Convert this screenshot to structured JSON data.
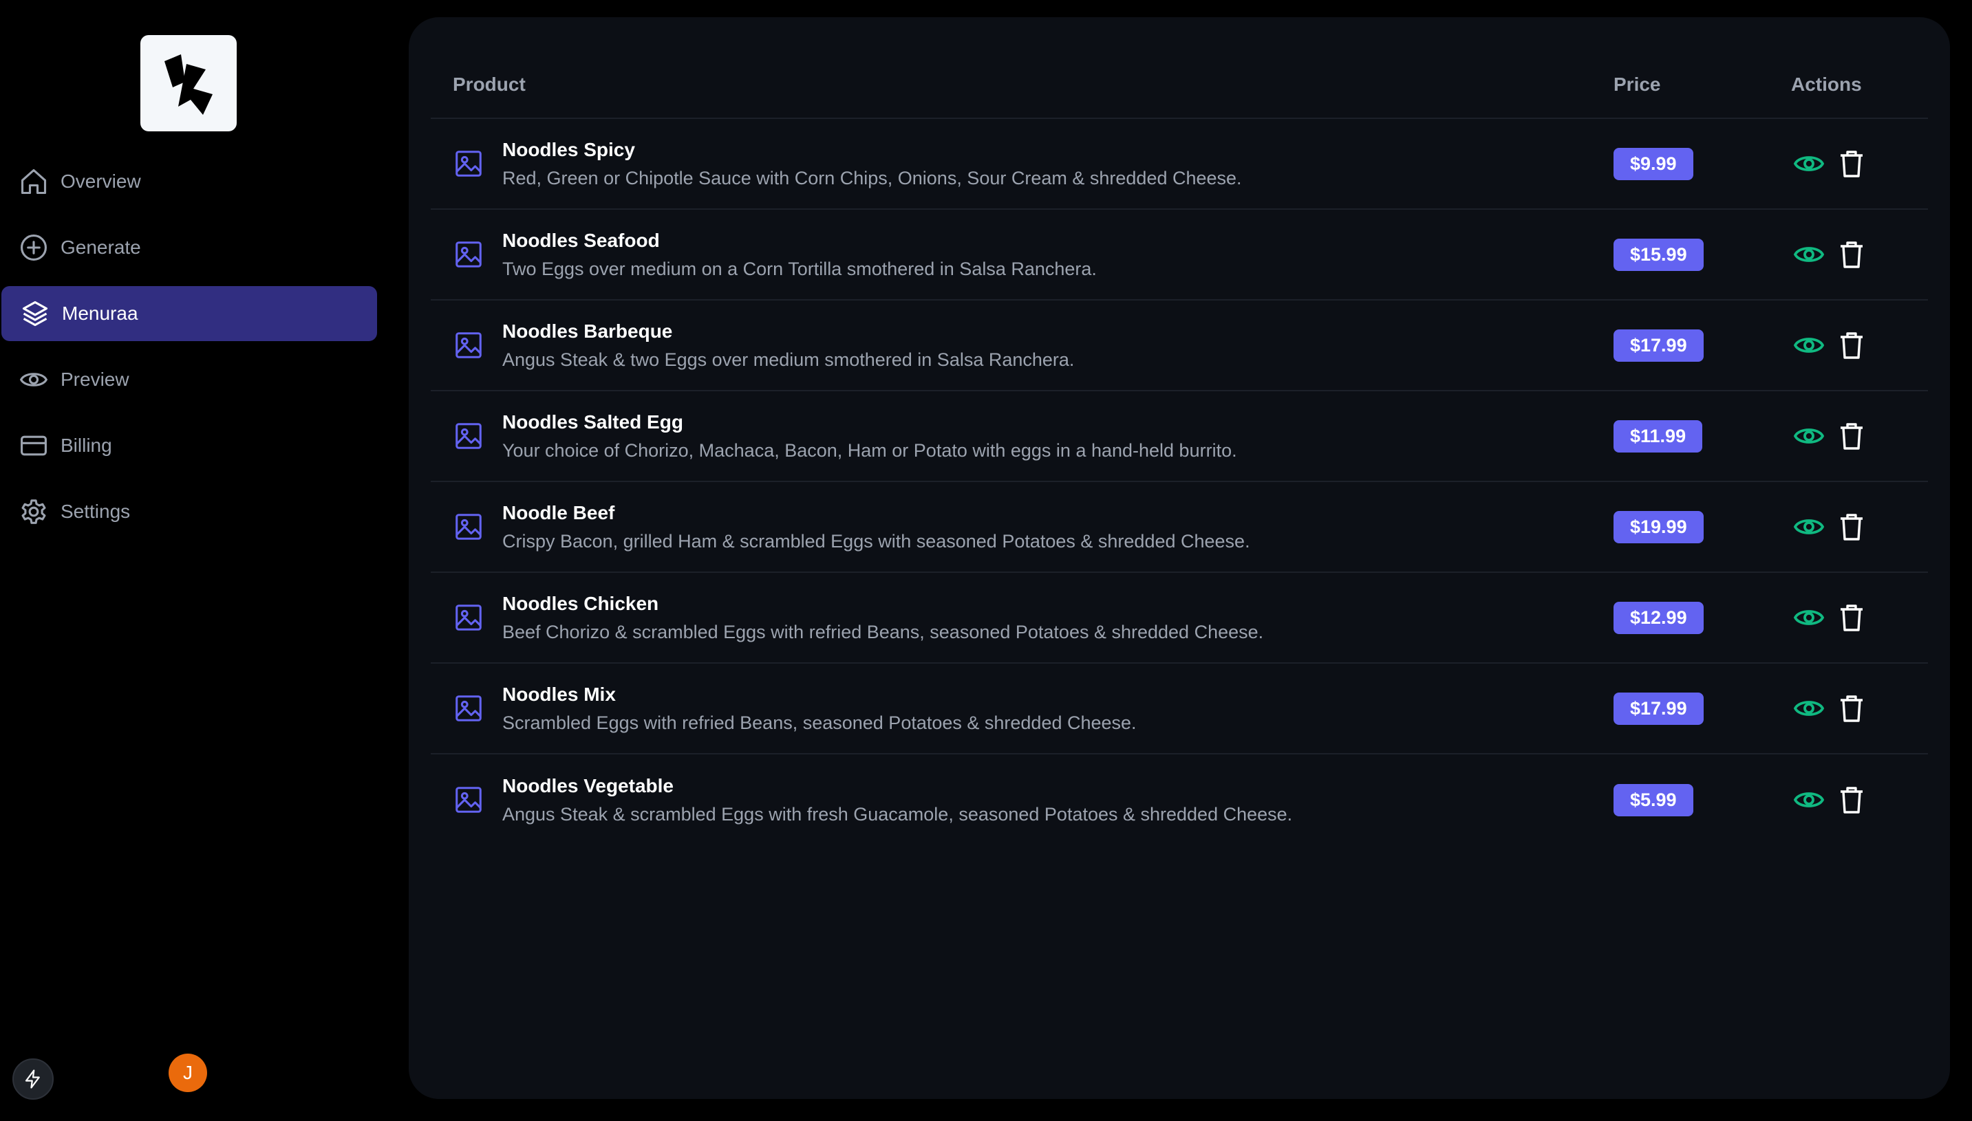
{
  "colors": {
    "accent": "#6363f1",
    "active_nav": "#312e81",
    "eye": "#10b981",
    "panel": "#0c0f15",
    "avatar": "#ea6a0c"
  },
  "sidebar": {
    "items": [
      {
        "label": "Overview",
        "icon": "home-icon"
      },
      {
        "label": "Generate",
        "icon": "plus-circle-icon"
      },
      {
        "label": "Menuraa",
        "icon": "layers-icon",
        "active": true
      },
      {
        "label": "Preview",
        "icon": "eye-icon"
      },
      {
        "label": "Billing",
        "icon": "credit-card-icon"
      },
      {
        "label": "Settings",
        "icon": "gear-icon"
      }
    ],
    "avatar_initial": "J"
  },
  "table": {
    "headers": {
      "product": "Product",
      "price": "Price",
      "actions": "Actions"
    },
    "rows": [
      {
        "name": "Noodles Spicy",
        "desc": "Red, Green or Chipotle Sauce with Corn Chips, Onions, Sour Cream & shredded Cheese.",
        "price": "$9.99"
      },
      {
        "name": "Noodles Seafood",
        "desc": "Two Eggs over medium on a Corn Tortilla smothered in Salsa Ranchera.",
        "price": "$15.99"
      },
      {
        "name": "Noodles Barbeque",
        "desc": "Angus Steak & two Eggs over medium smothered in Salsa Ranchera.",
        "price": "$17.99"
      },
      {
        "name": "Noodles Salted Egg",
        "desc": "Your choice of Chorizo, Machaca, Bacon, Ham or Potato with eggs in a hand-held burrito.",
        "price": "$11.99"
      },
      {
        "name": "Noodle Beef",
        "desc": "Crispy Bacon, grilled Ham & scrambled Eggs with seasoned Potatoes & shredded Cheese.",
        "price": "$19.99"
      },
      {
        "name": "Noodles Chicken",
        "desc": "Beef Chorizo & scrambled Eggs with refried Beans, seasoned Potatoes & shredded Cheese.",
        "price": "$12.99"
      },
      {
        "name": "Noodles Mix",
        "desc": "Scrambled Eggs with refried Beans, seasoned Potatoes & shredded Cheese.",
        "price": "$17.99"
      },
      {
        "name": "Noodles Vegetable",
        "desc": "Angus Steak & scrambled Eggs with fresh Guacamole, seasoned Potatoes & shredded Cheese.",
        "price": "$5.99"
      }
    ]
  }
}
